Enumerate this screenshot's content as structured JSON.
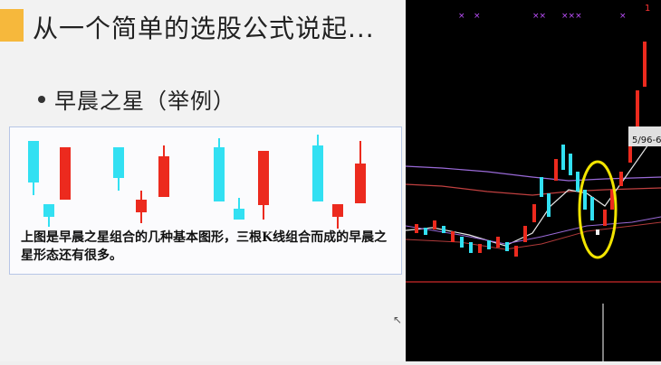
{
  "slide": {
    "title": "从一个简单的选股公式说起...",
    "bullet": "早晨之星（举例）",
    "caption": "上图是早晨之星组合的几种基本图形，三根K线组合而成的早晨之星形态还有很多。"
  },
  "example_patterns": [
    {
      "bear": {
        "open": 0.65,
        "close": 0.25,
        "high": 0.62,
        "low": 0.18
      }
    },
    {
      "bear": {
        "open": 0.58,
        "close": 0.35,
        "high": 0.6,
        "low": 0.15
      }
    },
    {
      "bear": {
        "open": 0.63,
        "close": 0.22,
        "high": 0.68,
        "low": 0.1
      }
    },
    {
      "bear": {
        "open": 0.66,
        "close": 0.25,
        "high": 0.68,
        "low": 0.16
      }
    }
  ],
  "chart_panel": {
    "label": "5/96-6",
    "corner_label": "1"
  },
  "colors": {
    "accent": "#f6b83c",
    "bear": "#32e0f2",
    "bull": "#ec2a1e",
    "chart_bg": "#000000",
    "highlight_circle": "#f2e400",
    "axis": "#ff3434"
  }
}
